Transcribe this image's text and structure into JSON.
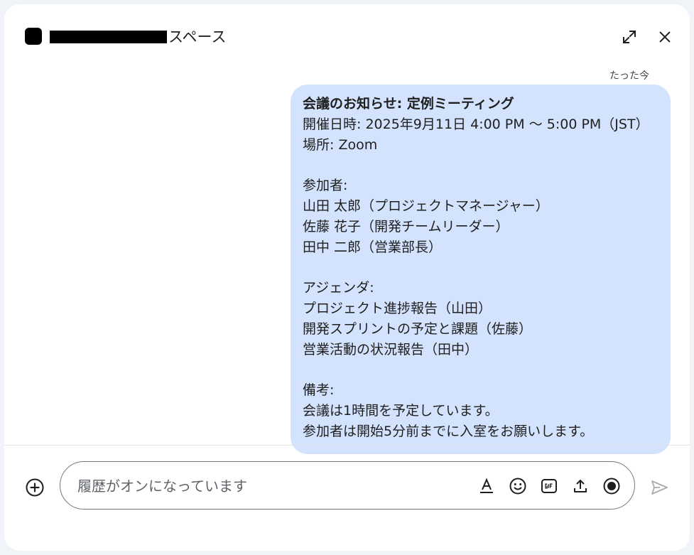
{
  "header": {
    "title_suffix": "スペース",
    "icons": {
      "expand": "expand-icon",
      "close": "close-icon"
    }
  },
  "message": {
    "timestamp": "たった今",
    "title": "会議のお知らせ: 定例ミーティング",
    "lines": [
      "開催日時: 2025年9月11日 4:00 PM 〜 5:00 PM（JST）",
      "場所: Zoom",
      "",
      "参加者:",
      "山田 太郎（プロジェクトマネージャー）",
      "佐藤 花子（開発チームリーダー）",
      "田中 二郎（営業部長）",
      "",
      "アジェンダ:",
      "プロジェクト進捗報告（山田）",
      "開発スプリントの予定と課題（佐藤）",
      "営業活動の状況報告（田中）",
      "",
      "備考:",
      "会議は1時間を予定しています。",
      "参加者は開始5分前までに入室をお願いします。"
    ],
    "bubble_color": "#d3e3fd"
  },
  "composer": {
    "placeholder": "履歴がオンになっています",
    "value": "",
    "tools": [
      "text-format-icon",
      "emoji-icon",
      "gif-icon",
      "upload-icon",
      "record-icon"
    ],
    "add_icon": "add-circle-icon",
    "send_icon": "send-icon"
  }
}
